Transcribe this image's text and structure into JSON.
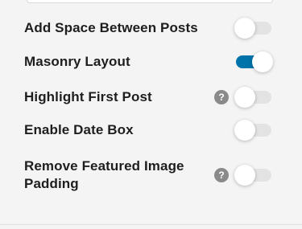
{
  "settings": [
    {
      "label": "Add Space Between Posts",
      "enabled": false,
      "has_help": false
    },
    {
      "label": "Masonry Layout",
      "enabled": true,
      "has_help": false
    },
    {
      "label": "Highlight First Post",
      "enabled": false,
      "has_help": true
    },
    {
      "label": "Enable Date Box",
      "enabled": false,
      "has_help": false
    },
    {
      "label": "Remove Featured Image Padding",
      "enabled": false,
      "has_help": true
    }
  ],
  "help_glyph": "?",
  "icons": {
    "help": "question-circle-icon",
    "toggle": "toggle-switch"
  },
  "colors": {
    "toggle_on": "#0073aa",
    "toggle_off": "#e3e3e3",
    "help_bg": "#8a8a8a"
  }
}
